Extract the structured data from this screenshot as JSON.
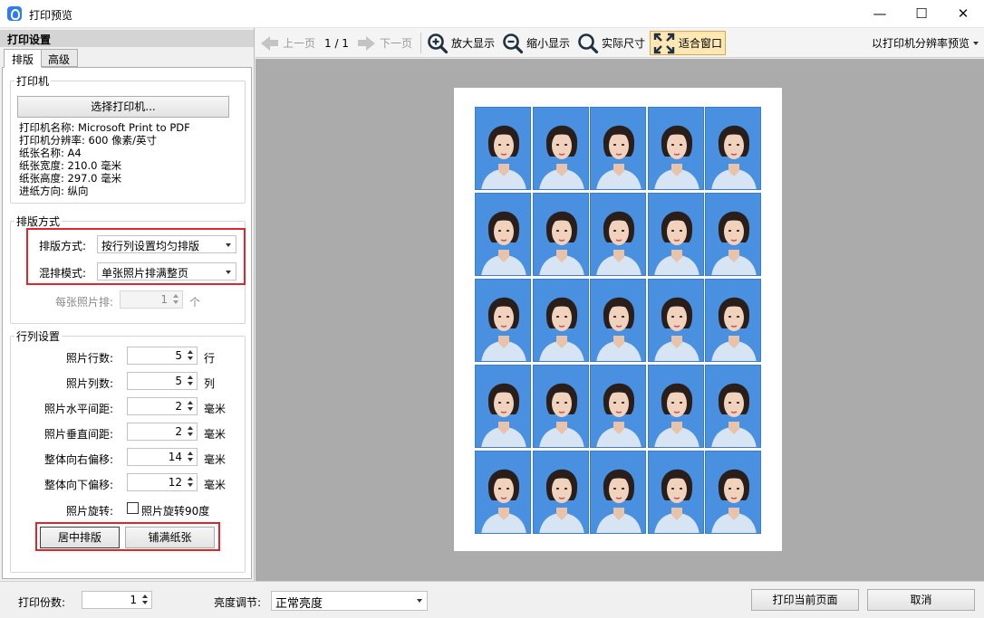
{
  "window": {
    "title": "打印预览",
    "min_glyph": "—",
    "max_glyph": "☐",
    "close_glyph": "✕"
  },
  "left_panel": {
    "header": "打印设置",
    "tabs": [
      "排版",
      "高级"
    ],
    "printer_group": {
      "legend": "打印机",
      "select_button": "选择打印机...",
      "info": [
        "打印机名称: Microsoft Print to PDF",
        "打印机分辨率: 600 像素/英寸",
        "纸张名称: A4",
        "纸张宽度: 210.0 毫米",
        "纸张高度: 297.0 毫米",
        "进纸方向: 纵向"
      ]
    },
    "layout_group": {
      "legend": "排版方式",
      "mode_label": "排版方式:",
      "mode_value": "按行列设置均匀排版",
      "mix_label": "混排模式:",
      "mix_value": "单张照片排满整页",
      "per_photo_label": "每张照片排:",
      "per_photo_value": "1",
      "per_photo_unit": "个"
    },
    "grid_group": {
      "legend": "行列设置",
      "rows": [
        {
          "label": "照片行数:",
          "value": "5",
          "unit": "行"
        },
        {
          "label": "照片列数:",
          "value": "5",
          "unit": "列"
        },
        {
          "label": "照片水平间距:",
          "value": "2",
          "unit": "毫米"
        },
        {
          "label": "照片垂直间距:",
          "value": "2",
          "unit": "毫米"
        },
        {
          "label": "整体向右偏移:",
          "value": "14",
          "unit": "毫米"
        },
        {
          "label": "整体向下偏移:",
          "value": "12",
          "unit": "毫米"
        }
      ],
      "rotate_label": "照片旋转:",
      "rotate_checkbox": "照片旋转90度",
      "center_button": "居中排版",
      "fill_button": "铺满纸张"
    }
  },
  "toolbar": {
    "prev": "上一页",
    "page_indicator": "1 / 1",
    "next": "下一页",
    "zoom_in": "放大显示",
    "zoom_out": "缩小显示",
    "actual_size": "实际尺寸",
    "fit_window": "适合窗口",
    "preview_mode": "以打印机分辨率预览"
  },
  "preview": {
    "rows": 5,
    "cols": 5,
    "photo_bg": "#4a90e0"
  },
  "bottom": {
    "copies_label": "打印份数:",
    "copies_value": "1",
    "brightness_label": "亮度调节:",
    "brightness_value": "正常亮度",
    "print_button": "打印当前页面",
    "cancel_button": "取消"
  }
}
